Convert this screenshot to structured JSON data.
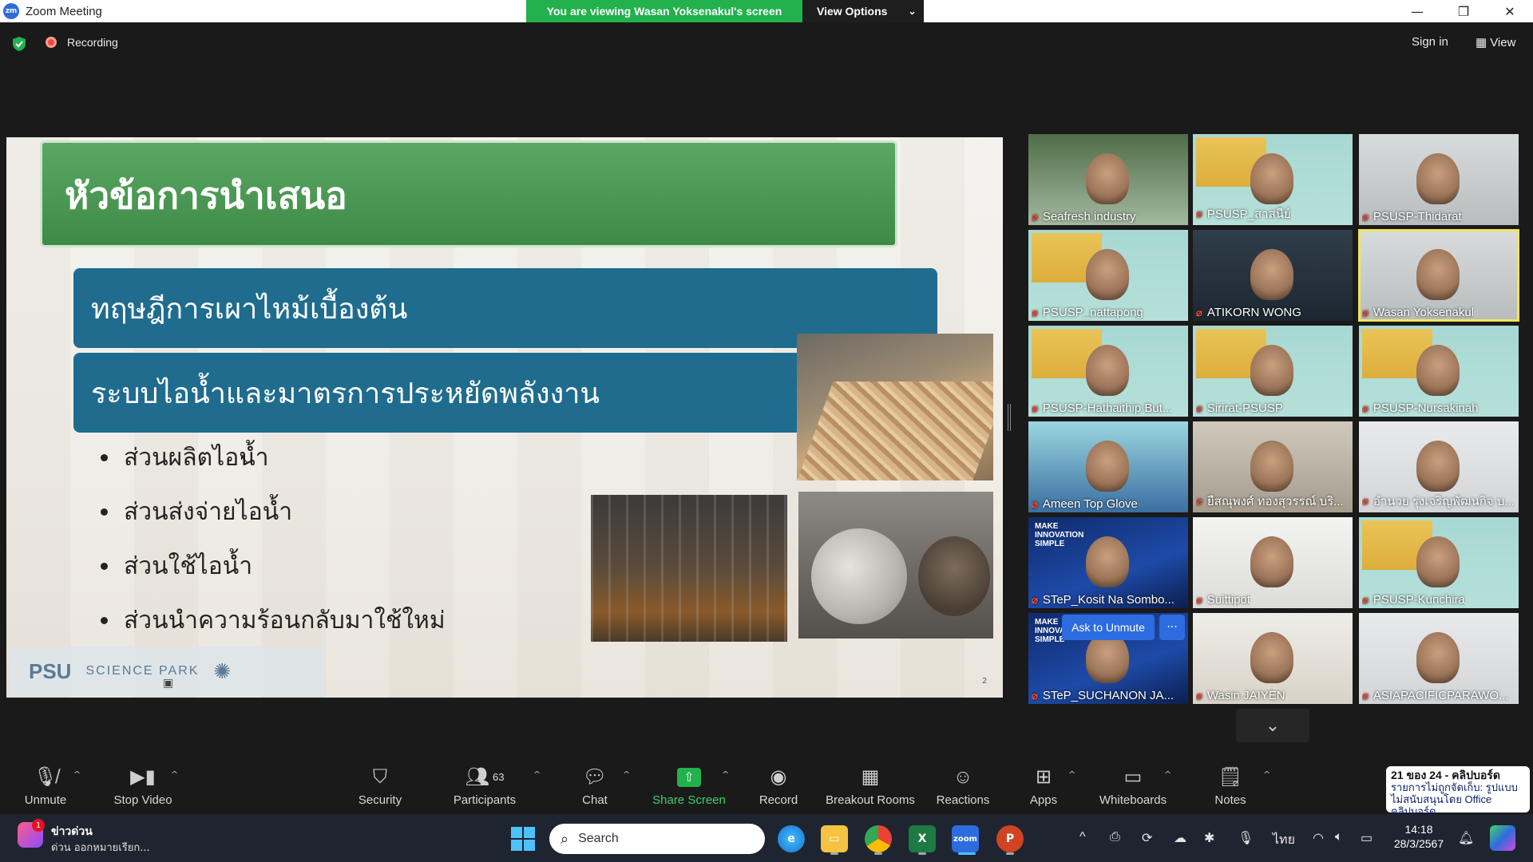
{
  "window": {
    "title": "Zoom Meeting",
    "logo_text": "zm",
    "viewing_banner": "You are viewing Wasan Yoksenakul's screen",
    "view_options": "View Options"
  },
  "topbar": {
    "recording_label": "Recording",
    "sign_in": "Sign in",
    "view": "View"
  },
  "slide": {
    "title": "หัวข้อการนำเสนอ",
    "band1": "ทฤษฎีการเผาไหม้เบื้องต้น",
    "band2": "ระบบไอน้ำและมาตรการประหยัดพลังงาน",
    "bullets": [
      "ส่วนผลิตไอน้ำ",
      "ส่วนส่งจ่ายไอน้ำ",
      "ส่วนใช้ไอน้ำ",
      "ส่วนนำความร้อนกลับมาใช้ใหม่"
    ],
    "logo_psu": "PSU",
    "logo_park": "SCIENCE PARK",
    "page_number": "2"
  },
  "participants": [
    {
      "name": "Seafresh industry",
      "bg": "bg-green"
    },
    {
      "name": "PSUSP_สาสนีย์",
      "bg": "bg-poster"
    },
    {
      "name": "PSUSP-Thidarat",
      "bg": "bg-room"
    },
    {
      "name": "PSUSP_nattapong",
      "bg": "bg-poster"
    },
    {
      "name": "ATIKORN WONG",
      "bg": "bg-dark"
    },
    {
      "name": "Wasan Yoksenakul",
      "bg": "bg-room",
      "active": true
    },
    {
      "name": "PSUSP-Hathaithip But...",
      "bg": "bg-poster"
    },
    {
      "name": "Sirirat-PSUSP",
      "bg": "bg-poster"
    },
    {
      "name": "PSUSP-Nursakinah",
      "bg": "bg-poster"
    },
    {
      "name": "Ameen Top Glove",
      "bg": "bg-teal"
    },
    {
      "name": "ยืสณุพงศ์ ทองสุวรรณ์ บริ...",
      "bg": "bg-office"
    },
    {
      "name": "อำนวย รุ่งเจริญพัฒนกิจ บ...",
      "bg": "bg-white"
    },
    {
      "name": "STeP_Kosit Na Sombo...",
      "bg": "bg-blue"
    },
    {
      "name": "Suittipot",
      "bg": "bg-plant"
    },
    {
      "name": "PSUSP-Kunchira",
      "bg": "bg-poster"
    },
    {
      "name": "STeP_SUCHANON JA...",
      "bg": "bg-blue"
    },
    {
      "name": "Wasin JAIYEN",
      "bg": "bg-shelf"
    },
    {
      "name": "ASIAPACIFICPARAWO...",
      "bg": "bg-white"
    }
  ],
  "blue_tile_text": "MAKE\nINNOVATION\nSIMPLE",
  "ask_to_unmute": "Ask to Unmute",
  "more": "···",
  "toolbar": {
    "unmute": "Unmute",
    "stop_video": "Stop Video",
    "security": "Security",
    "participants": "Participants",
    "participants_count": "63",
    "chat": "Chat",
    "share_screen": "Share Screen",
    "record": "Record",
    "breakout_rooms": "Breakout Rooms",
    "reactions": "Reactions",
    "apps": "Apps",
    "whiteboards": "Whiteboards",
    "notes": "Notes"
  },
  "notification": {
    "title": "21 ของ 24 - คลิปบอร์ด",
    "body": "รายการไม่ถูกจัดเก็บ: รูปแบบไม่สนับสนุนโดย Office คลิปบอร์ด"
  },
  "taskbar": {
    "news_badge": "1",
    "news_title": "ข่าวด่วน",
    "news_sub": "ด่วน ออกหมายเรียก...",
    "search_placeholder": "Search",
    "language": "ไทย",
    "time": "14:18",
    "date": "28/3/2567"
  },
  "colors": {
    "share_green": "#22b14c",
    "slide_title_green": "#3e8a47",
    "band_blue": "#1f6c8f",
    "zoom_blue": "#2d6cdf",
    "mute_red": "#e74c3c"
  }
}
